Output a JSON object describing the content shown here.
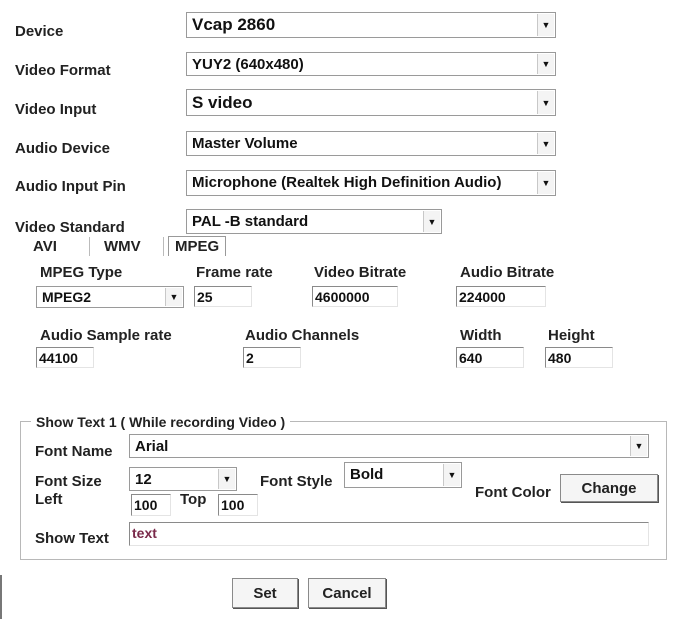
{
  "labels": {
    "device": "Device",
    "video_format": "Video Format",
    "video_input": "Video Input",
    "audio_device": "Audio Device",
    "audio_input_pin": "Audio Input Pin",
    "video_standard": "Video Standard"
  },
  "selects": {
    "device": "Vcap 2860",
    "video_format": "YUY2 (640x480)",
    "video_input": "S video",
    "audio_device": "Master Volume",
    "audio_input_pin": "Microphone (Realtek High Definition Audio)",
    "video_standard": "PAL -B standard"
  },
  "tabs": [
    "AVI",
    "WMV",
    "MPEG"
  ],
  "active_tab": "MPEG",
  "mpeg": {
    "type_label": "MPEG Type",
    "type_value": "MPEG2",
    "frame_rate_label": "Frame rate",
    "frame_rate_value": "25",
    "video_bitrate_label": "Video Bitrate",
    "video_bitrate_value": "4600000",
    "audio_bitrate_label": "Audio Bitrate",
    "audio_bitrate_value": "224000",
    "audio_sample_rate_label": "Audio Sample rate",
    "audio_sample_rate_value": "44100",
    "audio_channels_label": "Audio Channels",
    "audio_channels_value": "2",
    "width_label": "Width",
    "width_value": "640",
    "height_label": "Height",
    "height_value": "480"
  },
  "show_text": {
    "group_title": "Show Text 1 ( While recording  Video )",
    "font_name_label": "Font Name",
    "font_name_value": "Arial",
    "font_size_label": "Font Size",
    "font_size_value": "12",
    "font_style_label": "Font Style",
    "font_style_value": "Bold",
    "font_color_label": "Font Color",
    "change_button": "Change",
    "left_label": "Left",
    "left_value": "100",
    "top_label": "Top",
    "top_value": "100",
    "show_text_label": "Show Text",
    "show_text_value": "text",
    "show_text_color": "#7a2a4a"
  },
  "buttons": {
    "set": "Set",
    "cancel": "Cancel"
  },
  "icons": {
    "dropdown": "▼"
  }
}
